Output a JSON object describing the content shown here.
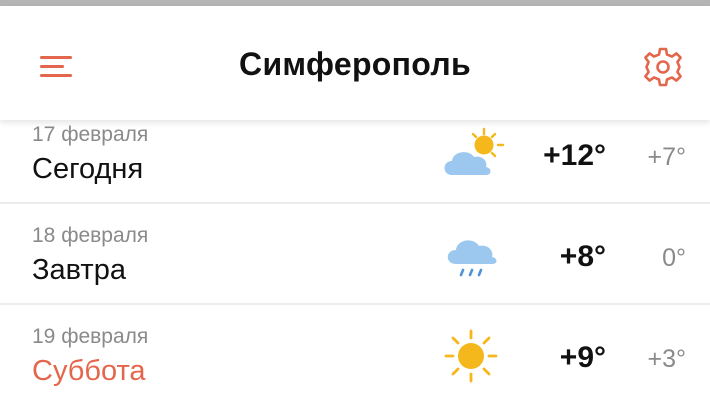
{
  "header": {
    "city": "Симферополь",
    "menu_icon": "hamburger-menu-icon",
    "settings_icon": "gear-icon"
  },
  "colors": {
    "accent": "#e4664c",
    "sun": "#f5b81c",
    "cloud": "#9cc8ef",
    "rain": "#4f94d4",
    "muted_text": "#8a8a8a"
  },
  "forecast": [
    {
      "date": "17 февраля",
      "day": "Сегодня",
      "icon": "partly-cloudy-icon",
      "temp_day": "+12°",
      "temp_night": "+7°",
      "weekend": false
    },
    {
      "date": "18 февраля",
      "day": "Завтра",
      "icon": "rain-cloud-icon",
      "temp_day": "+8°",
      "temp_night": "0°",
      "weekend": false
    },
    {
      "date": "19 февраля",
      "day": "Суббота",
      "icon": "sun-icon",
      "temp_day": "+9°",
      "temp_night": "+3°",
      "weekend": true
    }
  ]
}
